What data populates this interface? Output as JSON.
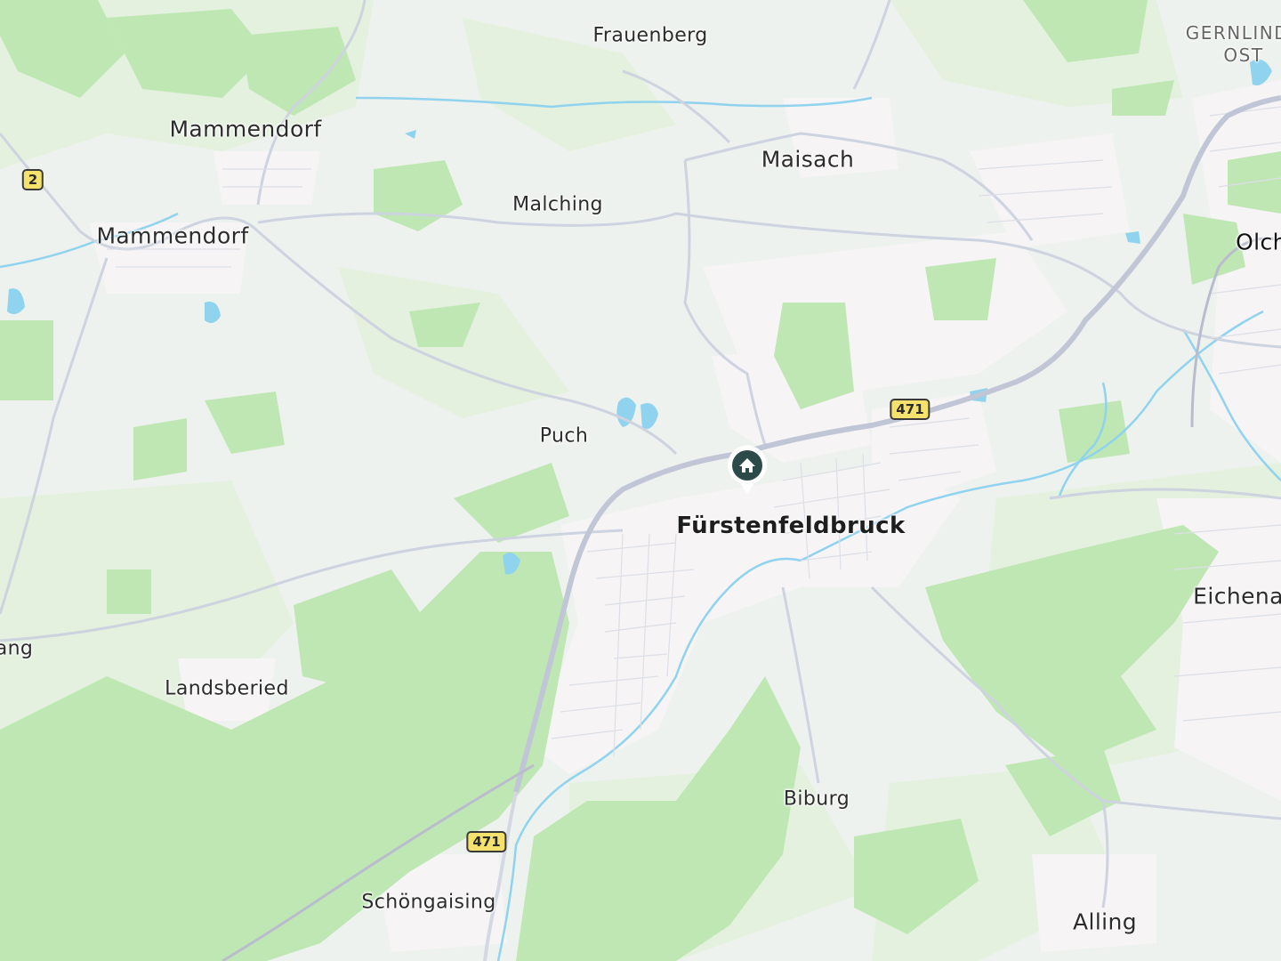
{
  "map": {
    "places": [
      {
        "id": "frauenberg",
        "name": "Frauenberg",
        "size": "small"
      },
      {
        "id": "mammendorf-north",
        "name": "Mammendorf",
        "size": "medium"
      },
      {
        "id": "mammendorf",
        "name": "Mammendorf",
        "size": "medium"
      },
      {
        "id": "malching",
        "name": "Malching",
        "size": "small"
      },
      {
        "id": "maisach",
        "name": "Maisach",
        "size": "medium"
      },
      {
        "id": "gernlinden-ost",
        "name": "GERNLINDE\nOST",
        "size": "district"
      },
      {
        "id": "olching",
        "name": "Olch",
        "size": "medium"
      },
      {
        "id": "puch",
        "name": "Puch",
        "size": "small"
      },
      {
        "id": "fuerstenfeldbruck",
        "name": "Fürstenfeldbruck",
        "size": "large"
      },
      {
        "id": "eichenau",
        "name": "Eichena",
        "size": "medium"
      },
      {
        "id": "landsberied",
        "name": "Landsberied",
        "size": "small"
      },
      {
        "id": "jesenwang",
        "name": "ang",
        "size": "small"
      },
      {
        "id": "biburg",
        "name": "Biburg",
        "size": "small"
      },
      {
        "id": "schoengaising",
        "name": "Schöngaising",
        "size": "small"
      },
      {
        "id": "alling",
        "name": "Alling",
        "size": "medium"
      }
    ],
    "road_shields": [
      {
        "id": "b2",
        "label": "2"
      },
      {
        "id": "b471-east",
        "label": "471"
      },
      {
        "id": "b471-south",
        "label": "471"
      }
    ],
    "marker": {
      "type": "home",
      "icon": "home-icon",
      "color": "#2d4a4a"
    },
    "colors": {
      "land": "#eef2ee",
      "forest": "#c2e8b8",
      "meadow": "#e4f1e0",
      "urban": "#f5f3f4",
      "water": "#8fd3ef",
      "road": "#c9cfdb",
      "railway": "#b8bacc",
      "shield_fill": "#f5e26c"
    }
  }
}
